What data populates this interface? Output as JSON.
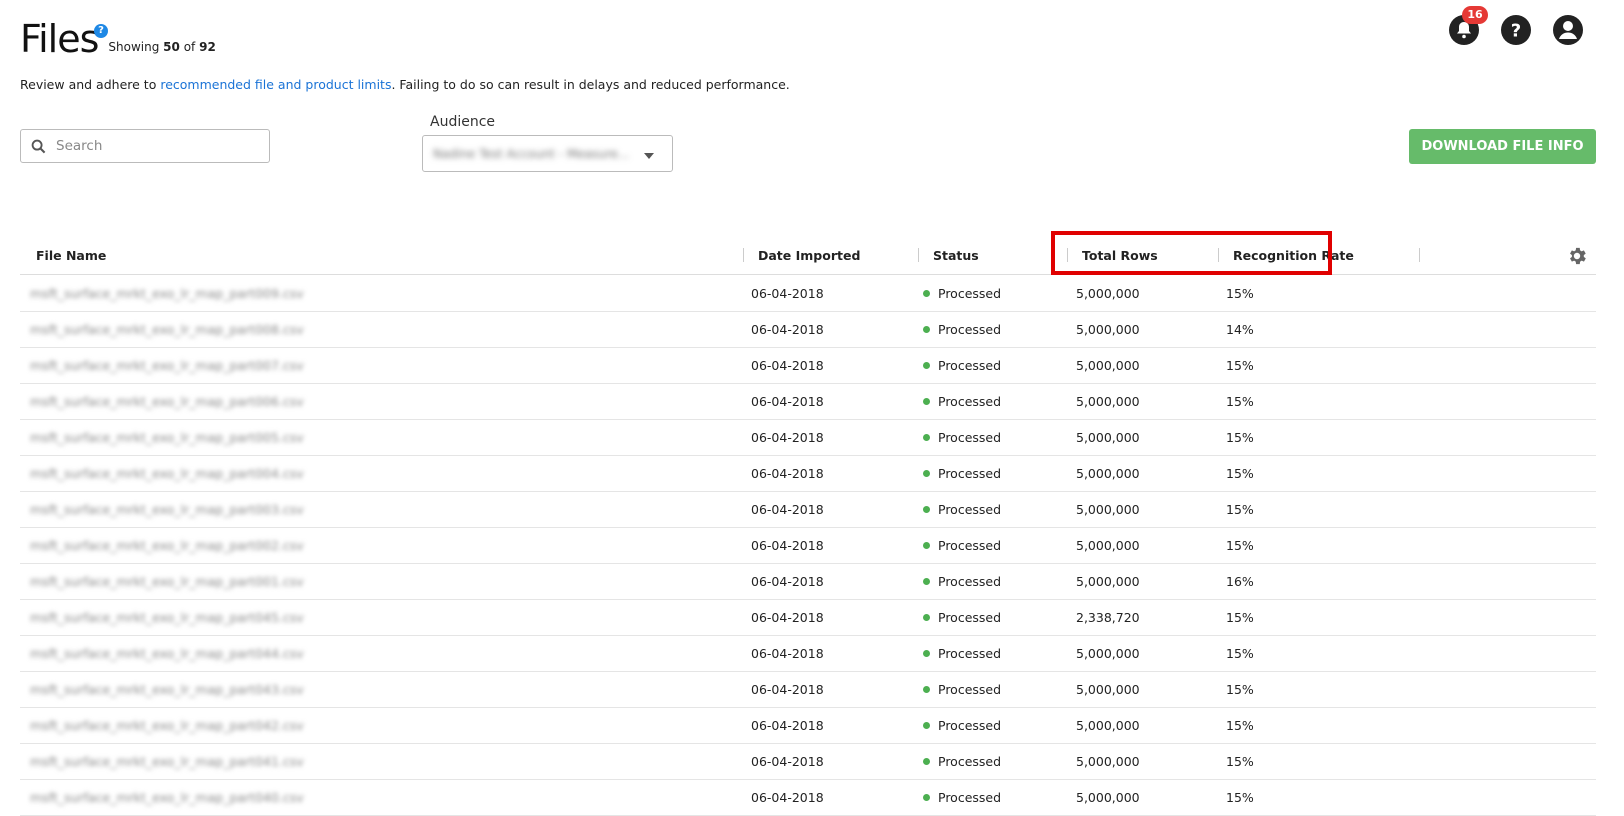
{
  "header": {
    "title": "Files",
    "help_badge": "?",
    "showing_prefix": "Showing",
    "showing_count": "50",
    "showing_of": "of",
    "showing_total": "92",
    "notice_prefix": "Review and adhere to ",
    "notice_link": "recommended file and product limits",
    "notice_suffix": ". Failing to do so can result in delays and reduced performance.",
    "notification_count": "16",
    "icons": [
      "bell-icon",
      "help-icon",
      "account-icon"
    ]
  },
  "controls": {
    "search_placeholder": "Search",
    "audience_label": "Audience",
    "audience_value": "Nadine Test Account - Measure...",
    "download_button": "DOWNLOAD FILE INFO"
  },
  "table": {
    "columns": [
      "File Name",
      "Date Imported",
      "Status",
      "Total Rows",
      "Recognition Rate"
    ],
    "rows": [
      {
        "file": "msft_surface_mrkt_exo_lr_map_part009.csv",
        "date": "06-04-2018",
        "status": "Processed",
        "rows": "5,000,000",
        "rate": "15%"
      },
      {
        "file": "msft_surface_mrkt_exo_lr_map_part008.csv",
        "date": "06-04-2018",
        "status": "Processed",
        "rows": "5,000,000",
        "rate": "14%"
      },
      {
        "file": "msft_surface_mrkt_exo_lr_map_part007.csv",
        "date": "06-04-2018",
        "status": "Processed",
        "rows": "5,000,000",
        "rate": "15%"
      },
      {
        "file": "msft_surface_mrkt_exo_lr_map_part006.csv",
        "date": "06-04-2018",
        "status": "Processed",
        "rows": "5,000,000",
        "rate": "15%"
      },
      {
        "file": "msft_surface_mrkt_exo_lr_map_part005.csv",
        "date": "06-04-2018",
        "status": "Processed",
        "rows": "5,000,000",
        "rate": "15%"
      },
      {
        "file": "msft_surface_mrkt_exo_lr_map_part004.csv",
        "date": "06-04-2018",
        "status": "Processed",
        "rows": "5,000,000",
        "rate": "15%"
      },
      {
        "file": "msft_surface_mrkt_exo_lr_map_part003.csv",
        "date": "06-04-2018",
        "status": "Processed",
        "rows": "5,000,000",
        "rate": "15%"
      },
      {
        "file": "msft_surface_mrkt_exo_lr_map_part002.csv",
        "date": "06-04-2018",
        "status": "Processed",
        "rows": "5,000,000",
        "rate": "15%"
      },
      {
        "file": "msft_surface_mrkt_exo_lr_map_part001.csv",
        "date": "06-04-2018",
        "status": "Processed",
        "rows": "5,000,000",
        "rate": "16%"
      },
      {
        "file": "msft_surface_mrkt_exo_lr_map_part045.csv",
        "date": "06-04-2018",
        "status": "Processed",
        "rows": "2,338,720",
        "rate": "15%"
      },
      {
        "file": "msft_surface_mrkt_exo_lr_map_part044.csv",
        "date": "06-04-2018",
        "status": "Processed",
        "rows": "5,000,000",
        "rate": "15%"
      },
      {
        "file": "msft_surface_mrkt_exo_lr_map_part043.csv",
        "date": "06-04-2018",
        "status": "Processed",
        "rows": "5,000,000",
        "rate": "15%"
      },
      {
        "file": "msft_surface_mrkt_exo_lr_map_part042.csv",
        "date": "06-04-2018",
        "status": "Processed",
        "rows": "5,000,000",
        "rate": "15%"
      },
      {
        "file": "msft_surface_mrkt_exo_lr_map_part041.csv",
        "date": "06-04-2018",
        "status": "Processed",
        "rows": "5,000,000",
        "rate": "15%"
      },
      {
        "file": "msft_surface_mrkt_exo_lr_map_part040.csv",
        "date": "06-04-2018",
        "status": "Processed",
        "rows": "5,000,000",
        "rate": "15%"
      }
    ]
  },
  "colors": {
    "link": "#1a73d6",
    "download_button": "#66bb6a",
    "status_processed": "#4caf50",
    "highlight": "#e00000",
    "badge": "#e53935"
  }
}
